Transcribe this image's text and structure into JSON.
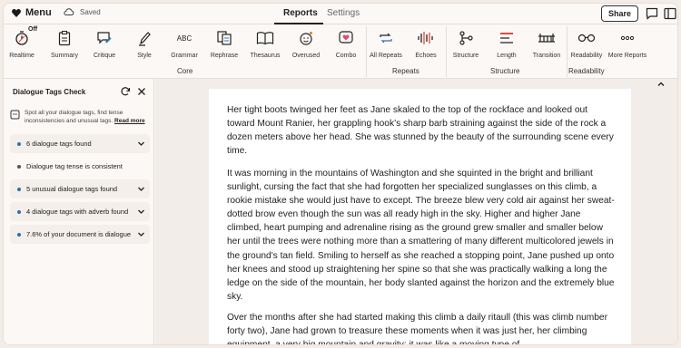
{
  "topbar": {
    "menu_label": "Menu",
    "saved_label": "Saved",
    "tabs": [
      {
        "label": "Reports",
        "active": true
      },
      {
        "label": "Settings",
        "active": false
      }
    ],
    "share_label": "Share"
  },
  "toolbar": {
    "realtime_badge": "Off",
    "tools": [
      {
        "label": "Realtime",
        "icon": "stopwatch-icon"
      },
      {
        "label": "Summary",
        "icon": "clipboard-icon"
      },
      {
        "label": "Critique",
        "icon": "chat-edit-icon"
      },
      {
        "label": "Style",
        "icon": "pen-icon"
      },
      {
        "label": "Grammar",
        "icon": "abc-icon"
      },
      {
        "label": "Rephrase",
        "icon": "rephrase-icon"
      },
      {
        "label": "Thesaurus",
        "icon": "book-icon"
      },
      {
        "label": "Overused",
        "icon": "smiley-icon"
      },
      {
        "label": "Combo",
        "icon": "heart-chat-icon"
      },
      {
        "label": "All Repeats",
        "icon": "repeat-icon"
      },
      {
        "label": "Echoes",
        "icon": "waveform-icon"
      },
      {
        "label": "Structure",
        "icon": "nodes-icon"
      },
      {
        "label": "Length",
        "icon": "lines-icon"
      },
      {
        "label": "Transition",
        "icon": "bridge-icon"
      },
      {
        "label": "Readability",
        "icon": "glasses-icon"
      },
      {
        "label": "More Reports",
        "icon": "dots-icon"
      }
    ],
    "groups": [
      {
        "label": "Core"
      },
      {
        "label": "Repeats"
      },
      {
        "label": "Structure"
      },
      {
        "label": "Readability"
      }
    ]
  },
  "sidebar": {
    "title": "Dialogue Tags Check",
    "info_text": "Spot all your dialogue tags, find tense inconsistencies and unusual tags.",
    "read_more": "Read more",
    "items": [
      {
        "label": "6 dialogue tags found",
        "expandable": true,
        "dot_color": "#2f6fb3"
      },
      {
        "label": "Dialogue tag tense is consistent",
        "expandable": false,
        "dot_color": "#555555"
      },
      {
        "label": "5 unusual dialogue tags found",
        "expandable": true,
        "dot_color": "#2f6fb3"
      },
      {
        "label": "4 dialogue tags with adverb found",
        "expandable": true,
        "dot_color": "#2f6fb3"
      },
      {
        "label": "7.6% of your document is dialogue",
        "expandable": true,
        "dot_color": "#2f6fb3"
      }
    ]
  },
  "document": {
    "paragraphs": [
      "Her tight boots twinged her feet as Jane skaled to the top of the rockface and looked out toward Mount Ranier, her grappling hook’s sharp barb straining against the side of the rock a dozen meters above her head. She was stunned by the beauty of the surrounding scene every time.",
      "It was morning in the mountains of Washington and she squinted in the bright and brilliant sunlight, cursing the fact that she had forgotten her specialized sunglasses on this climb, a rookie mistake she would just have to except. The breeze blew very cold air against her sweat-dotted brow even though the sun was all ready high in the sky. Higher and higher Jane climbed, heart pumping and adrenaline rising as the ground grew smaller and smaller below her until the trees were nothing more than a smattering of many different multicolored jewels in the ground's tan field. Smiling to herself as she reached a stopping point, Jane pushed up onto her knees and stood up straightening her spine so that she was practically walking a long the ledge on the side of the mountain, her body slanted against  the horizon and the extremely blue sky.",
      "Over the months after she had started making this climb a daily ritaull (this was climb number forty two), Jane had grown to treasure these moments when it was just her, her climbing equipment, a very big mountain and gravity; it was like a moving type of"
    ]
  }
}
